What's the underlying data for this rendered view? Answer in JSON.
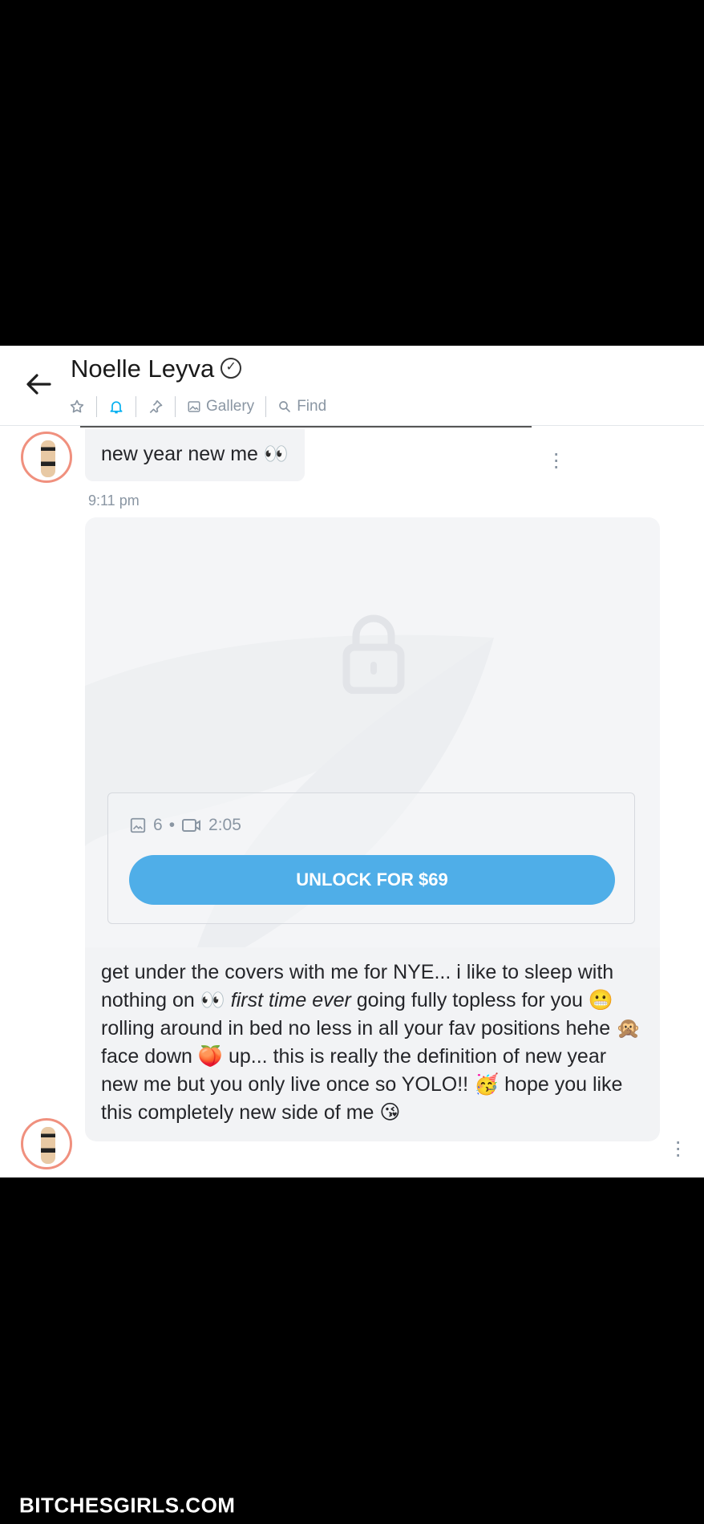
{
  "header": {
    "name": "Noelle Leyva",
    "back_icon": "arrow-left-icon",
    "toolbar": {
      "star_icon": "star-icon",
      "bell_icon": "bell-icon",
      "pin_icon": "pin-icon",
      "gallery_label": "Gallery",
      "find_label": "Find"
    },
    "accent": "#00aff0"
  },
  "messages": {
    "first": {
      "text": "new year new me 👀",
      "time": "9:11 pm"
    },
    "paid_post": {
      "photo_count": "6",
      "separator": "•",
      "video_duration": "2:05",
      "unlock_label": "UNLOCK FOR $69",
      "button_color": "#4faee8"
    },
    "second": {
      "part1": "get under the covers with me for NYE... i like to sleep with nothing on 👀 ",
      "italic": "first time ever",
      "part2": " going fully topless for you 😬 rolling around in bed no less in all your fav positions hehe 🙊 face down 🍑 up... this is really the definition of new year new me but you only live once so YOLO!! 🥳 hope you like this completely new side of me 😘"
    }
  },
  "watermark": "BITCHESGIRLS.COM"
}
